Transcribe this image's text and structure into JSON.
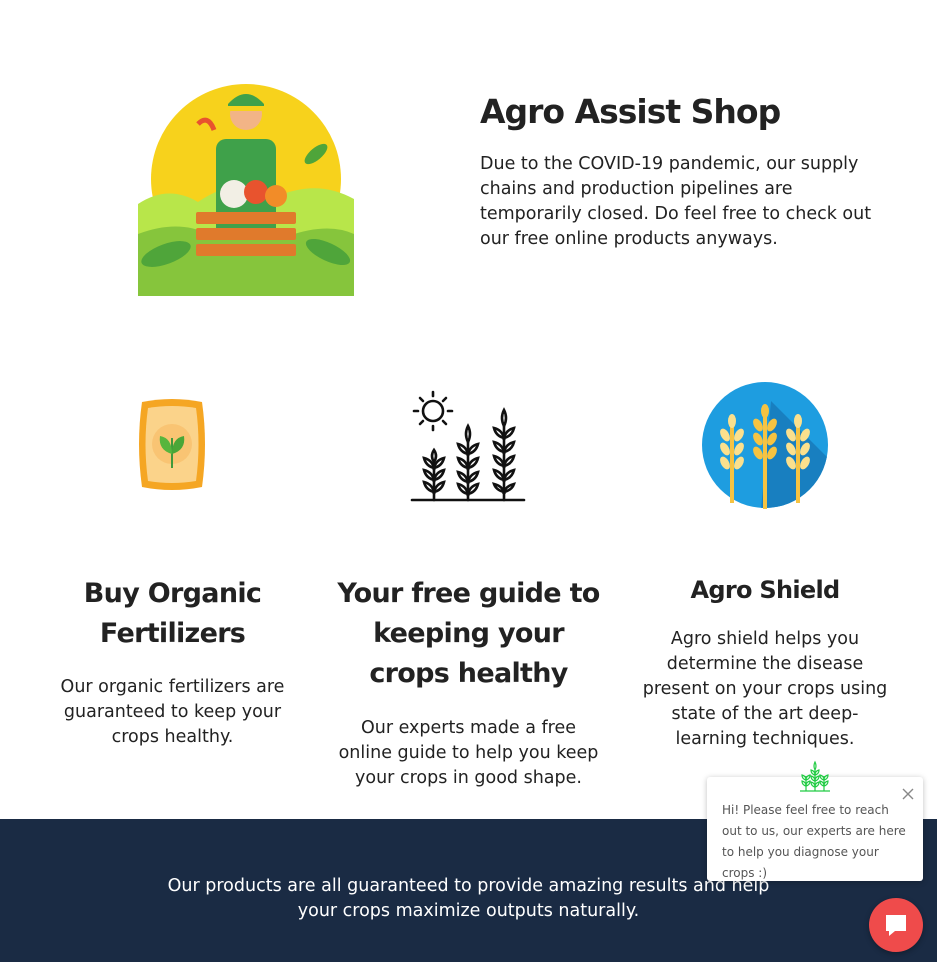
{
  "hero": {
    "title": "Agro Assist Shop",
    "text": "Due to the COVID-19 pandemic, our supply chains and production pipelines are temporarily closed. Do feel free to check out our free online products anyways.",
    "image_icon": "farmer-with-vegetable-crate"
  },
  "features": [
    {
      "icon": "fertilizer-bag-icon",
      "title": "Buy Organic Fertilizers",
      "text": "Our organic fertilizers are guaranteed to keep your crops healthy."
    },
    {
      "icon": "wheat-field-sun-icon",
      "title": "Your free guide to keeping your crops healthy",
      "text": "Our experts made a free online guide to help you keep your crops in good shape."
    },
    {
      "icon": "wheat-circle-icon",
      "title": "Agro Shield",
      "text": "Agro shield helps you determine the disease present on your crops using state of the art deep-learning techniques."
    }
  ],
  "band": {
    "text": "Our products are all guaranteed to provide amazing results and help your crops maximize outputs naturally.",
    "color": "#1a2b44"
  },
  "chat": {
    "message": "Hi! Please feel free to reach out to us, our experts are here to help you diagnose your crops :)",
    "bubble_color": "#ef4b4b",
    "logo_color": "#22cc44"
  }
}
